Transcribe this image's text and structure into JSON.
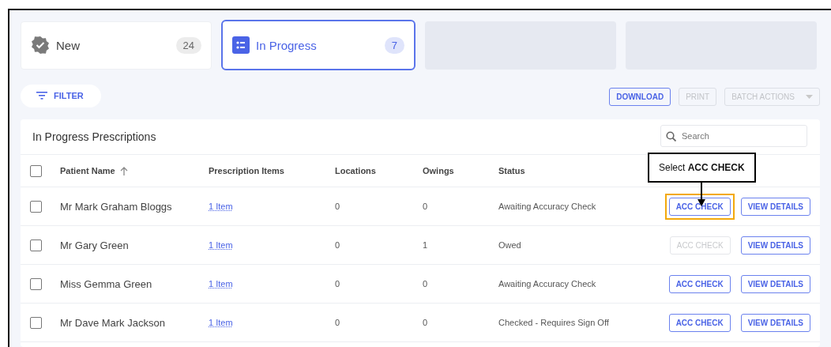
{
  "tabs": [
    {
      "kind": "card",
      "label": "New",
      "count": "24",
      "selected": false
    },
    {
      "kind": "card",
      "label": "In Progress",
      "count": "7",
      "selected": true
    },
    {
      "kind": "skeleton"
    },
    {
      "kind": "skeleton"
    }
  ],
  "filter": {
    "label": "FILTER"
  },
  "toolbar": [
    {
      "label": "DOWNLOAD",
      "disabled": false,
      "dropdown": false
    },
    {
      "label": "PRINT",
      "disabled": true,
      "dropdown": false
    },
    {
      "label": "BATCH ACTIONS",
      "disabled": true,
      "dropdown": true
    }
  ],
  "table": {
    "title": "In Progress Prescriptions",
    "search": {
      "placeholder": "Search"
    },
    "select_all": {
      "checked": false
    },
    "columns": [
      {
        "label": "Patient Name",
        "sorted": true
      },
      {
        "label": "Prescription Items",
        "sorted": false
      },
      {
        "label": "Locations",
        "sorted": false
      },
      {
        "label": "Owings",
        "sorted": false
      },
      {
        "label": "Status",
        "sorted": false
      }
    ],
    "rows": [
      {
        "checked": false,
        "patient": "Mr Mark Graham Bloggs",
        "items": "1 Item",
        "locations": "0",
        "owings": "0",
        "status": "Awaiting Accuracy Check",
        "acc_check": {
          "label": "ACC CHECK",
          "disabled": false,
          "highlighted": true
        },
        "view": "VIEW DETAILS"
      },
      {
        "checked": false,
        "patient": "Mr Gary Green",
        "items": "1 Item",
        "locations": "0",
        "owings": "1",
        "status": "Owed",
        "acc_check": {
          "label": "ACC CHECK",
          "disabled": true,
          "highlighted": false
        },
        "view": "VIEW DETAILS"
      },
      {
        "checked": false,
        "patient": "Miss Gemma Green",
        "items": "1 Item",
        "locations": "0",
        "owings": "0",
        "status": "Awaiting Accuracy Check",
        "acc_check": {
          "label": "ACC CHECK",
          "disabled": false,
          "highlighted": false
        },
        "view": "VIEW DETAILS"
      },
      {
        "checked": false,
        "patient": "Mr Dave Mark Jackson",
        "items": "1 Item",
        "locations": "0",
        "owings": "0",
        "status": "Checked - Requires Sign Off",
        "acc_check": {
          "label": "ACC CHECK",
          "disabled": false,
          "highlighted": false
        },
        "view": "VIEW DETAILS"
      }
    ]
  },
  "callout": {
    "text": "Select **ACC CHECK**"
  }
}
